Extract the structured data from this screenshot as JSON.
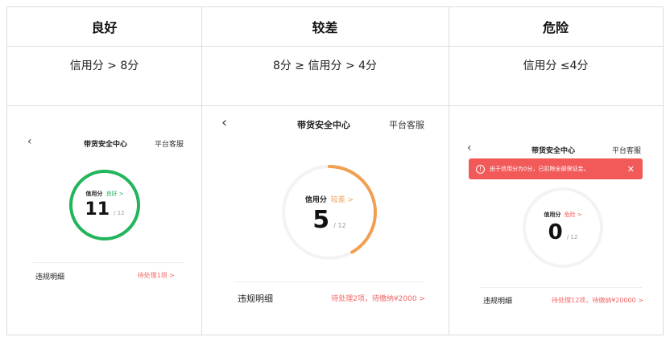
{
  "table": {
    "headers": [
      "良好",
      "较差",
      "危险"
    ],
    "conditions": [
      "信用分 > 8分",
      "8分 ≥ 信用分 > 4分",
      "信用分 ≤4分"
    ]
  },
  "screens": [
    {
      "nav_back": "‹",
      "title": "带货安全中心",
      "service": "平台客服",
      "score_label": "信用分",
      "status": "良好 >",
      "status_color": "#22b55c",
      "score": "11",
      "max": "/ 12",
      "progress": 1.0,
      "ring_color": "#22b55c",
      "detail_label": "违规明细",
      "pending": "待处理1项 >"
    },
    {
      "nav_back": "‹",
      "title": "带货安全中心",
      "service": "平台客服",
      "score_label": "信用分",
      "status": "较差 >",
      "status_color": "#f0a050",
      "score": "5",
      "max": "/ 12",
      "progress": 0.417,
      "ring_color": "#f0a050",
      "detail_label": "违规明细",
      "pending": "待处理2项，待缴纳¥2000 >"
    },
    {
      "nav_back": "‹",
      "title": "带货安全中心",
      "service": "平台客服",
      "alert_icon": "!",
      "alert": "由于信用分为0分，已扣除全部保证金。",
      "alert_close": "✕",
      "score_label": "信用分",
      "status": "危险 >",
      "status_color": "#f25a5a",
      "score": "0",
      "max": "/ 12",
      "progress": 0,
      "ring_color": "#f25a5a",
      "detail_label": "违规明细",
      "pending": "待处理12项，待缴纳¥20000 >"
    }
  ]
}
